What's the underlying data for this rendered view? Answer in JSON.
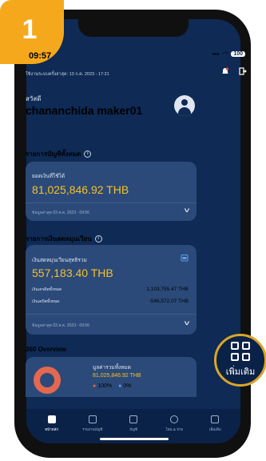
{
  "step": {
    "number": "1"
  },
  "status_bar": {
    "time": "09:57",
    "battery": "100"
  },
  "header": {
    "updated_text": "ใช้งานระบบครั้งล่าสุด: 13 ก.ค. 2023 - 17:21"
  },
  "greeting": {
    "label": "สวัสดี",
    "name": "chananchida maker01"
  },
  "accounts_section": {
    "title": "รายการบัญชีทั้งหมด",
    "balance_label": "ยอดเงินที่ใช้ได้",
    "balance": "81,025,846.92 THB",
    "footer": "ข้อมูลล่าสุด 03 ส.ค. 2023 - 09:56"
  },
  "liquidity_section": {
    "title": "รายการเงินสดหมุนเวียน",
    "net_label": "เงินสดหมุนเวียนสุทธิรวม",
    "net_amount": "557,183.40 THB",
    "inflow_label": "เงินเครดิตทั้งหมด",
    "inflow": "1,103,755.47 THB",
    "outflow_label": "เงินเดบิตทั้งหมด",
    "outflow": "-546,572.07 THB",
    "footer": "ข้อมูลล่าสุด 03 ส.ค. 2023 - 09:56"
  },
  "overview_section": {
    "title": "360 Overview",
    "label": "มูลค่ารวมทั้งหมด",
    "amount": "81,025,846.92 THB",
    "pct_a": "100%",
    "pct_b": "0%"
  },
  "bottom_nav": {
    "items": [
      {
        "label": "หน้าหลัก"
      },
      {
        "label": "รายงานบัญชี"
      },
      {
        "label": "บัญชี"
      },
      {
        "label": "โอน & จ่าย"
      },
      {
        "label": "เพิ่มเติม"
      }
    ]
  },
  "callout": {
    "label": "เพิ่มเติม"
  },
  "colors": {
    "accent": "#f6c02a",
    "badge": "#f6a81c",
    "background": "#0e2a55",
    "card": "#2b4a79"
  }
}
